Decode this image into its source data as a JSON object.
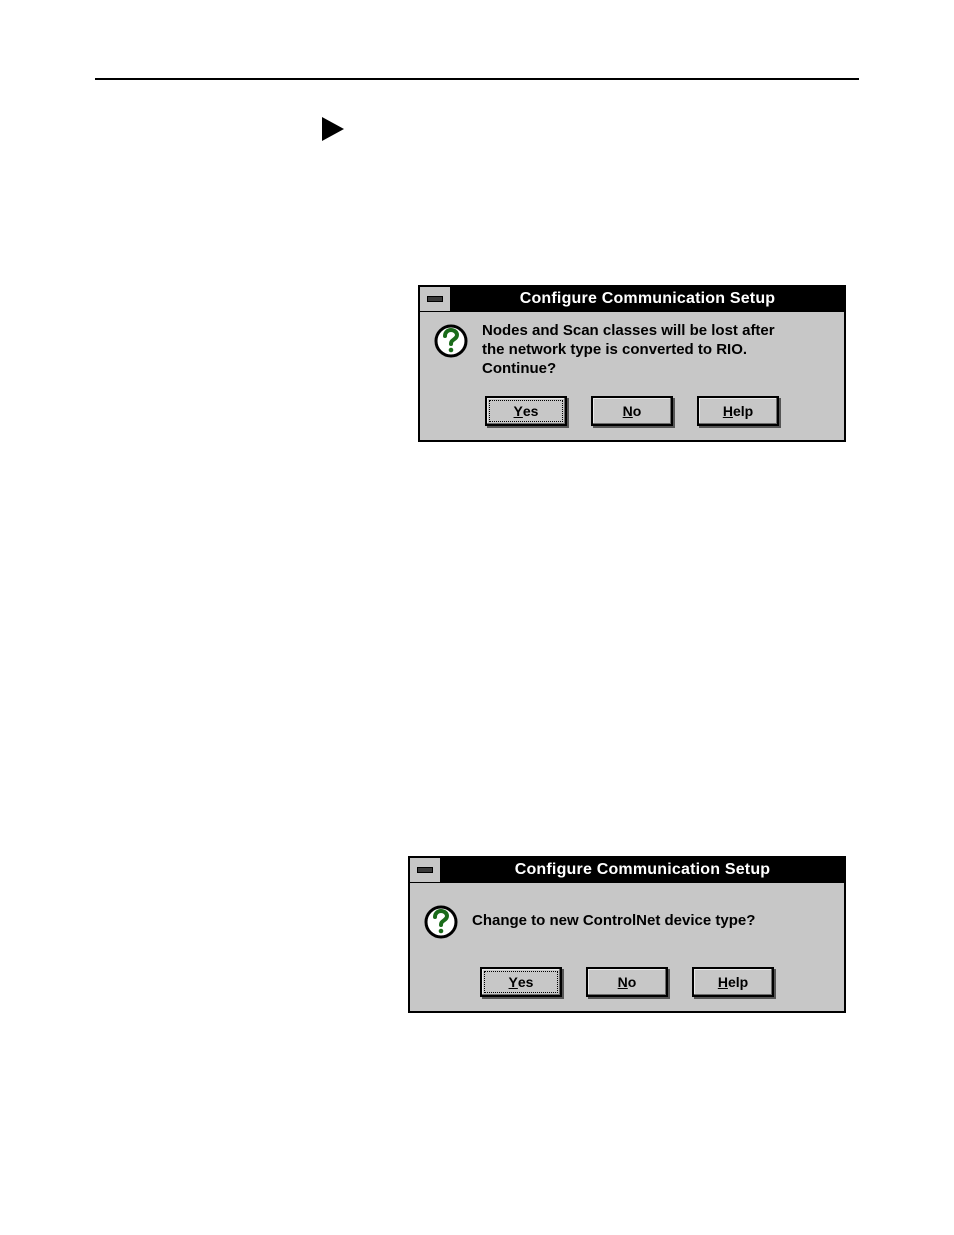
{
  "dialog1": {
    "title": "Configure Communication Setup",
    "message": "Nodes and Scan classes will be lost after\nthe network type is converted to RIO.\nContinue?",
    "buttons": {
      "yes": {
        "prefix": "Y",
        "rest": "es"
      },
      "no": {
        "prefix": "N",
        "rest": "o"
      },
      "help": {
        "prefix": "H",
        "rest": "elp"
      }
    }
  },
  "dialog2": {
    "title": "Configure Communication Setup",
    "message": "Change to new ControlNet device type?",
    "buttons": {
      "yes": {
        "prefix": "Y",
        "rest": "es"
      },
      "no": {
        "prefix": "N",
        "rest": "o"
      },
      "help": {
        "prefix": "H",
        "rest": "elp"
      }
    }
  },
  "icons": {
    "question": "question-mark-icon"
  }
}
